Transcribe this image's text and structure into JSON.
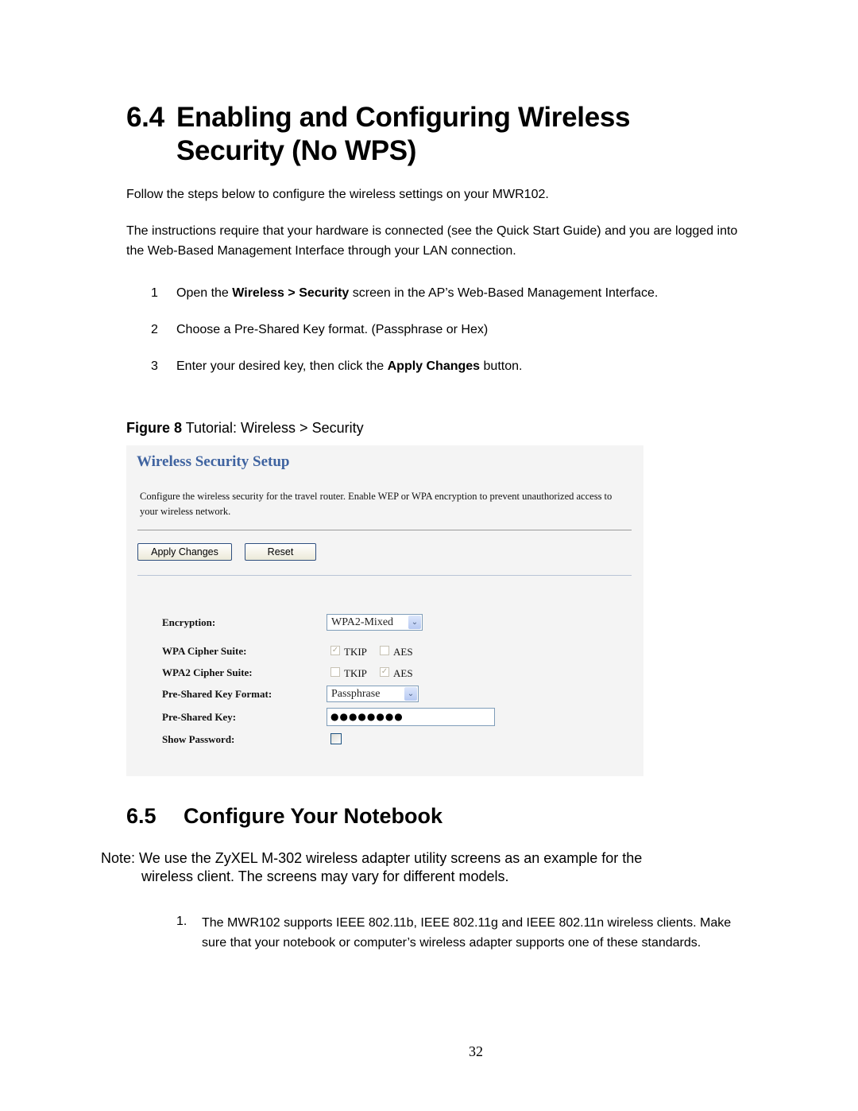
{
  "section_64": {
    "number": "6.4",
    "title": "Enabling and Configuring Wireless Security (No WPS)",
    "intro": "Follow the steps below to configure the wireless settings on your MWR102.",
    "requirements": "The instructions require that your hardware is connected (see the Quick Start Guide) and you are logged into the Web-Based Management Interface through your LAN connection.",
    "steps": [
      {
        "num": "1",
        "pre": "Open the ",
        "bold": "Wireless > Security",
        "post": " screen in the AP’s Web-Based Management Interface."
      },
      {
        "num": "2",
        "pre": "Choose a Pre-Shared Key format. (Passphrase or Hex)",
        "bold": "",
        "post": ""
      },
      {
        "num": "3",
        "pre": "Enter your desired key, then click the ",
        "bold": "Apply Changes",
        "post": " button."
      }
    ],
    "figure_label": "Figure 8",
    "figure_caption": " Tutorial: Wireless  > Security"
  },
  "screenshot": {
    "title": "Wireless Security Setup",
    "description": "Configure the wireless security for the travel router. Enable WEP or WPA encryption to prevent unauthorized access to your wireless network.",
    "apply_label": "Apply Changes",
    "reset_label": "Reset",
    "fields": {
      "encryption_label": "Encryption:",
      "encryption_value": "WPA2-Mixed",
      "wpa_cipher_label": "WPA Cipher Suite:",
      "wpa2_cipher_label": "WPA2 Cipher Suite:",
      "tkip": "TKIP",
      "aes": "AES",
      "wpa_tkip_checked": true,
      "wpa_aes_checked": false,
      "wpa2_tkip_checked": false,
      "wpa2_aes_checked": true,
      "psk_format_label": "Pre-Shared Key Format:",
      "psk_format_value": "Passphrase",
      "psk_label": "Pre-Shared Key:",
      "psk_value": "●●●●●●●●",
      "show_password_label": "Show Password:",
      "show_password_checked": false
    },
    "check_glyph": "✓",
    "dropdown_glyph": "⌄"
  },
  "section_65": {
    "number": "6.5",
    "title": "Configure Your Notebook",
    "note_line1": "Note: We use the ZyXEL M-302 wireless adapter utility screens as an example for the",
    "note_line2": "wireless client. The screens may vary for different models.",
    "list": [
      {
        "num": "1.",
        "text": "The MWR102 supports IEEE 802.11b, IEEE 802.11g and IEEE 802.11n wireless clients. Make sure that your notebook or computer’s wireless adapter supports one of these standards."
      }
    ]
  },
  "page_number": "32"
}
